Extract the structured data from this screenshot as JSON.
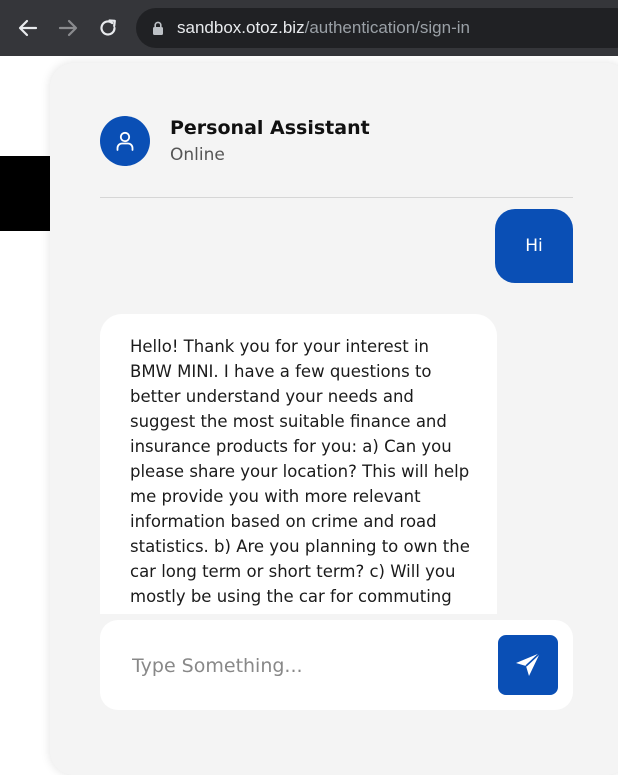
{
  "browser": {
    "url_domain": "sandbox.otoz.biz",
    "url_path": "/authentication/sign-in"
  },
  "chat": {
    "assistant_name": "Personal Assistant",
    "status": "Online",
    "messages": [
      {
        "from": "user",
        "text": "Hi"
      },
      {
        "from": "assistant",
        "text": "Hello! Thank you for your interest in BMW MINI. I have a few questions to better understand your needs and suggest the most suitable finance and insurance products for you: a) Can you please share your location? This will help me provide you with more relevant information based on crime and road statistics. b) Are you planning to own the car long term or short term? c) Will you mostly be using the car for commuting or weekend"
      }
    ],
    "input_placeholder": "Type Something..."
  },
  "colors": {
    "accent": "#0a4fb5",
    "panel_bg": "#f4f4f4"
  },
  "icons": {
    "back": "arrow-left-icon",
    "forward": "arrow-right-icon",
    "reload": "reload-icon",
    "lock": "lock-icon",
    "avatar": "user-icon",
    "send": "send-icon"
  }
}
